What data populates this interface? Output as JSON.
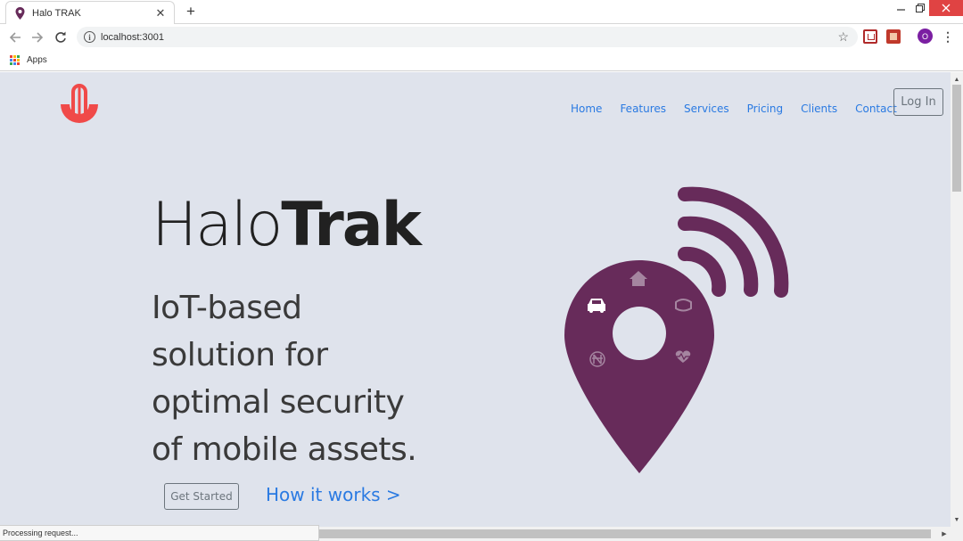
{
  "browser": {
    "tab_title": "Halo TRAK",
    "tab_close": "✕",
    "new_tab": "+",
    "url": "localhost:3001",
    "bookmark_apps": "Apps",
    "profile_initial": "O",
    "status_text": "Processing request..."
  },
  "header": {
    "nav": [
      "Home",
      "Features",
      "Services",
      "Pricing",
      "Clients",
      "Contact"
    ],
    "login_label": "Log In"
  },
  "hero": {
    "brand_light": "Halo",
    "brand_bold": "Trak",
    "tagline_lines": [
      "IoT-based",
      "solution for",
      "optimal security",
      "of mobile assets."
    ],
    "cta_label": "Get Started",
    "how_link": "How it works >"
  },
  "colors": {
    "logo_red": "#f04a49",
    "pin_purple": "#672b5a",
    "page_bg": "#dfe3ec",
    "link_blue": "#2a7ae2"
  },
  "icons": {
    "pin_icons": [
      "home-icon",
      "car-icon",
      "handshake-icon",
      "heart-pulse-icon",
      "naira-coin-icon"
    ]
  }
}
